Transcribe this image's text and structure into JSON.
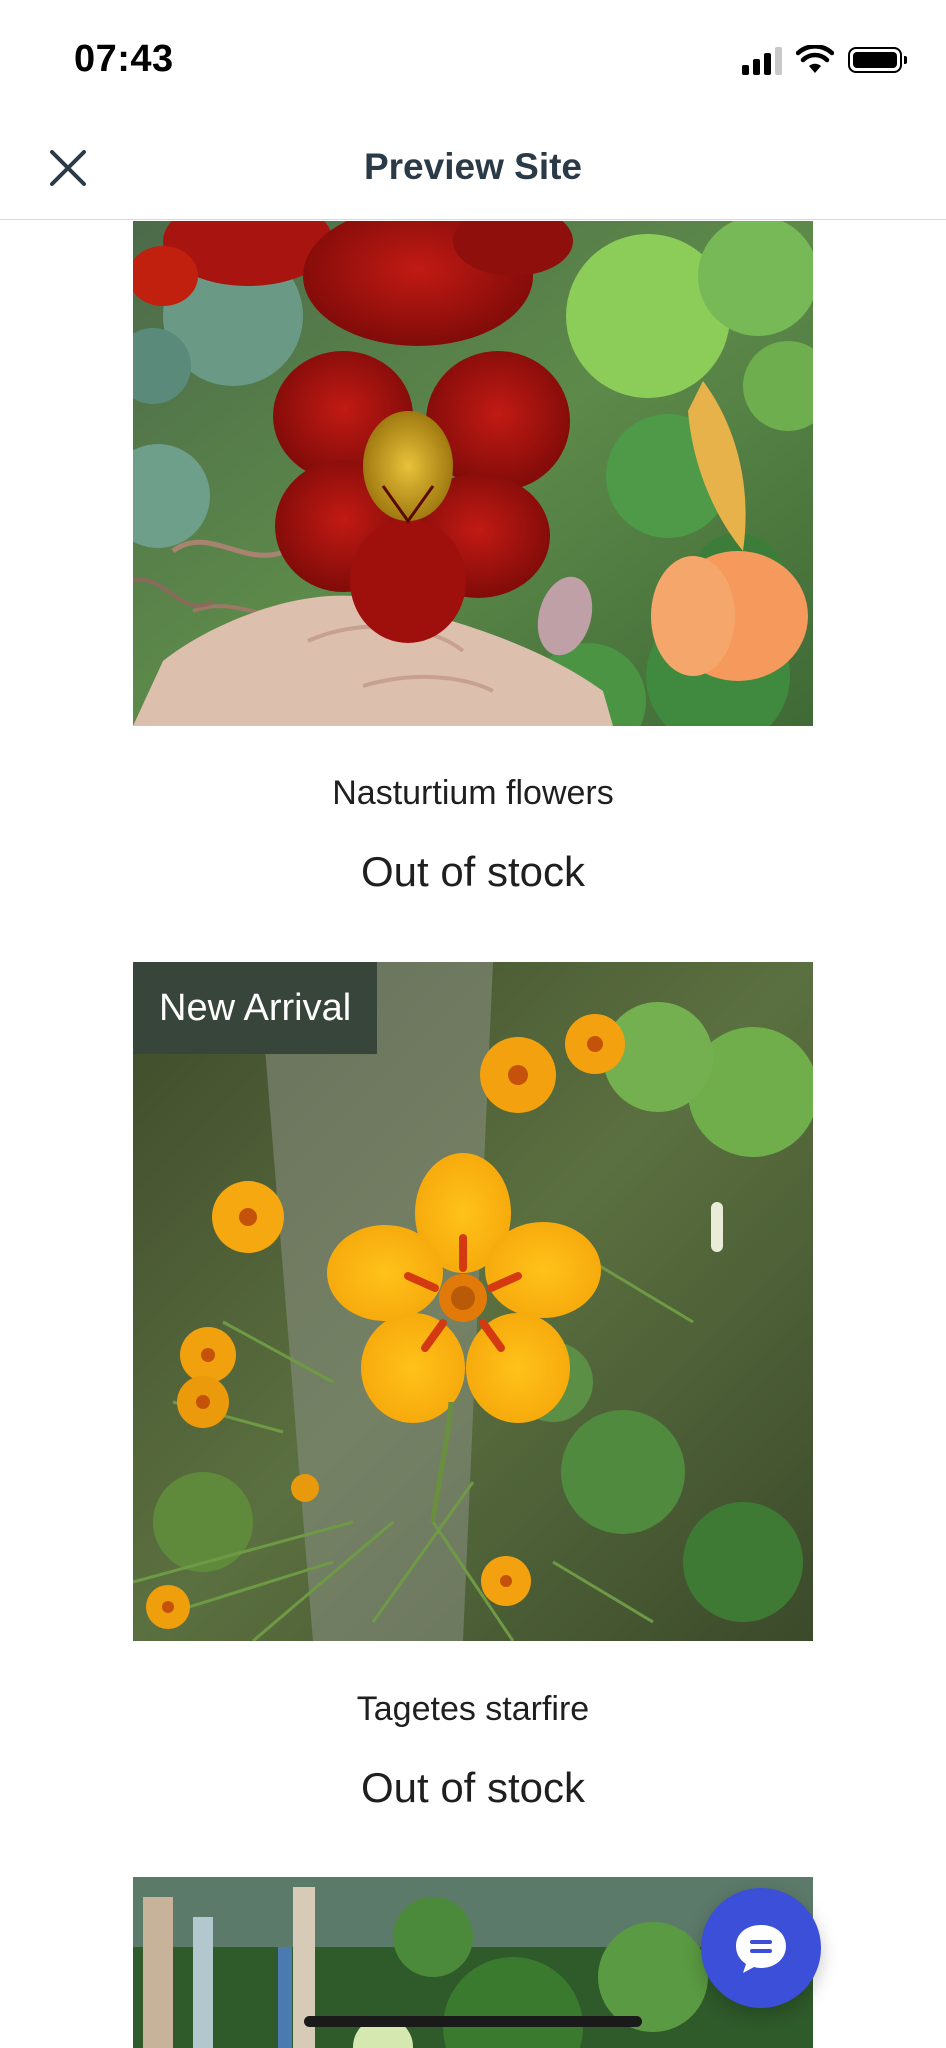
{
  "status_bar": {
    "time": "07:43"
  },
  "header": {
    "title": "Preview Site"
  },
  "products": [
    {
      "name": "Nasturtium flowers",
      "stock": "Out of stock"
    },
    {
      "name": "Tagetes starfire",
      "stock": "Out of stock",
      "badge": "New Arrival"
    }
  ],
  "colors": {
    "header_text": "#2b3a47",
    "badge_bg": "#37453a",
    "chat_button": "#3b4fd8"
  }
}
